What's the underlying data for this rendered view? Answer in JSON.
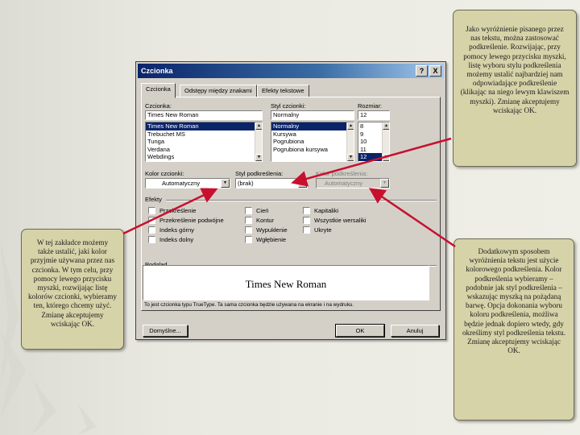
{
  "notes": {
    "top": "Jako wyróżnienie pisanego przez nas tekstu, można zastosować podkreślenie. Rozwijając, przy pomocy lewego przycisku myszki, listę wyboru stylu podkreślenia możemy ustalić najbardziej nam odpowiadające podkreślenie (klikając na niego lewym klawiszem myszki). Zmianę akceptujemy wciskając OK.",
    "left": "W tej zakładce możemy także ustalić, jaki kolor przyjmie używana przez nas czcionka. W tym celu, przy pomocy lewego przycisku myszki, rozwijając listę kolorów czcionki, wybieramy ten, którego chcemy użyć. Zmianę akceptujemy wciskając OK.",
    "right": "Dodatkowym sposobem wyróżnienia tekstu jest użycie kolorowego podkreślenia. Kolor podkreślenia wybieramy – podobnie jak styl podkreślenia – wskazując myszką na pożądaną barwę. Opcja dokonania wyboru koloru podkreślenia, możliwa będzie jednak dopiero wtedy, gdy określimy styl podkreślenia tekstu. Zmianę akceptujemy wciskając OK."
  },
  "dialog": {
    "title": "Czcionka",
    "help": "?",
    "close": "X",
    "tabs": [
      "Czcionka",
      "Odstępy między znakami",
      "Efekty tekstowe"
    ],
    "font": {
      "label": "Czcionka:",
      "value": "Times New Roman",
      "items": [
        "Times New Roman",
        "Trebuchet MS",
        "Tunga",
        "Verdana",
        "Webdings"
      ]
    },
    "style": {
      "label": "Styl czcionki:",
      "value": "Normalny",
      "items": [
        "Normalny",
        "Kursywa",
        "Pogrubiona",
        "Pogrubiona kursywa"
      ]
    },
    "size": {
      "label": "Rozmiar:",
      "value": "12",
      "items": [
        "8",
        "9",
        "10",
        "11",
        "12"
      ]
    },
    "font_color": {
      "label": "Kolor czcionki:",
      "value": "Automatyczny"
    },
    "underline_style": {
      "label": "Styl podkreślenia:",
      "value": "(brak)"
    },
    "underline_color": {
      "label": "Kolor podkreślenia:",
      "value": "Automatyczny"
    },
    "effects": {
      "label": "Efekty",
      "col1": [
        "Przekreślenie",
        "Przekreślenie podwójne",
        "Indeks górny",
        "Indeks dolny"
      ],
      "col2": [
        "Cień",
        "Kontur",
        "Wypukłenie",
        "Wgłębienie"
      ],
      "col3": [
        "Kapitaliki",
        "Wszystkie wersaliki",
        "Ukryte"
      ]
    },
    "preview": {
      "label": "Podgląd",
      "text": "Times New Roman",
      "note": "To jest czcionka typu TrueType. Ta sama czcionka będzie używana na ekranie i na wydruku."
    },
    "buttons": {
      "default": "Domyślne...",
      "ok": "OK",
      "cancel": "Anuluj"
    }
  },
  "colors": {
    "note_bg": "#d6d3a9",
    "arrow": "#c8102e",
    "title_bar": "#0a246a",
    "selection": "#0a246a"
  }
}
